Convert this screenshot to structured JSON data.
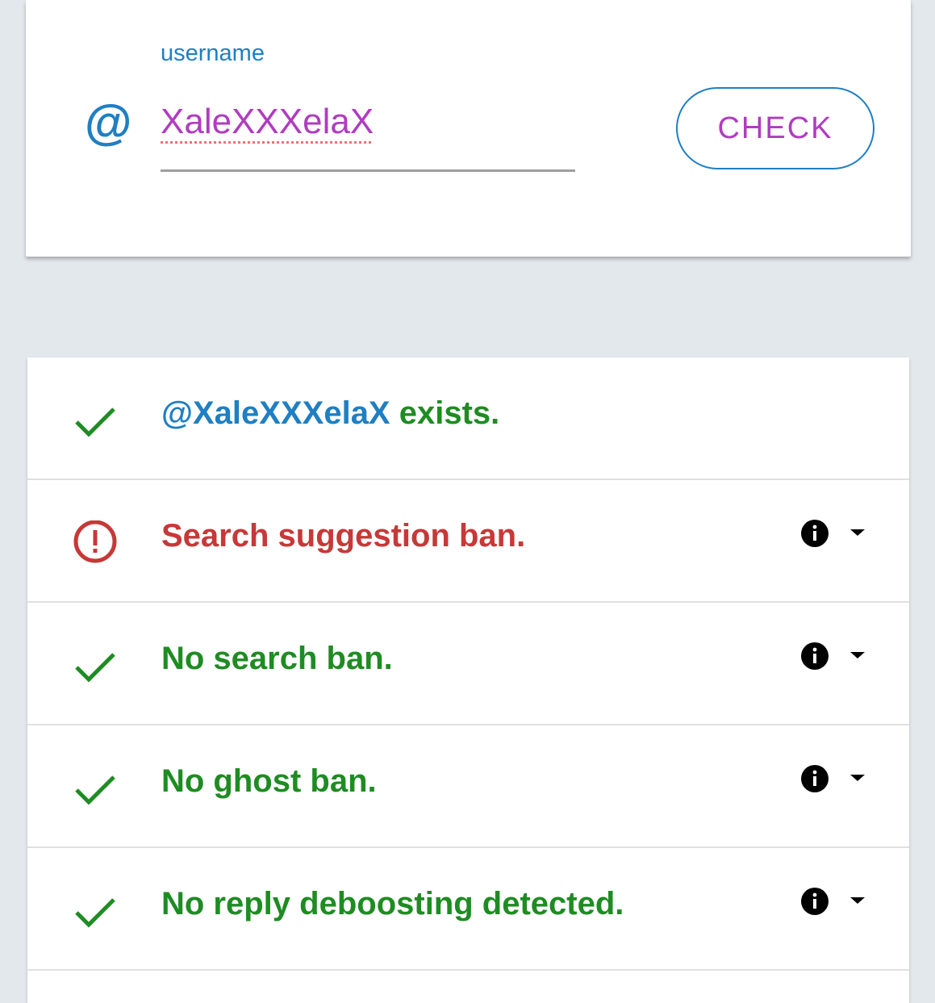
{
  "search_card": {
    "field_label": "username",
    "at_symbol": "@",
    "input_value": "XaleXXXelaX",
    "check_label": "CHECK"
  },
  "results": [
    {
      "status": "ok",
      "handle": "@XaleXXXelaX",
      "text": " exists.",
      "has_info": false
    },
    {
      "status": "warning",
      "text": "Search suggestion ban.",
      "has_info": true
    },
    {
      "status": "ok",
      "text": "No search ban.",
      "has_info": true
    },
    {
      "status": "ok",
      "text": "No ghost ban.",
      "has_info": true
    },
    {
      "status": "ok",
      "text": "No reply deboosting detected.",
      "has_info": true
    }
  ],
  "icons": {
    "ok": "check-icon",
    "warning": "alert-circle-icon",
    "info": "info-icon",
    "expand": "caret-down-icon"
  },
  "colors": {
    "accent_blue": "#1f7fc2",
    "input_purple": "#b03cc0",
    "ok_green": "#1e8c22",
    "error_red": "#c73838",
    "background": "#e3e8ec"
  }
}
